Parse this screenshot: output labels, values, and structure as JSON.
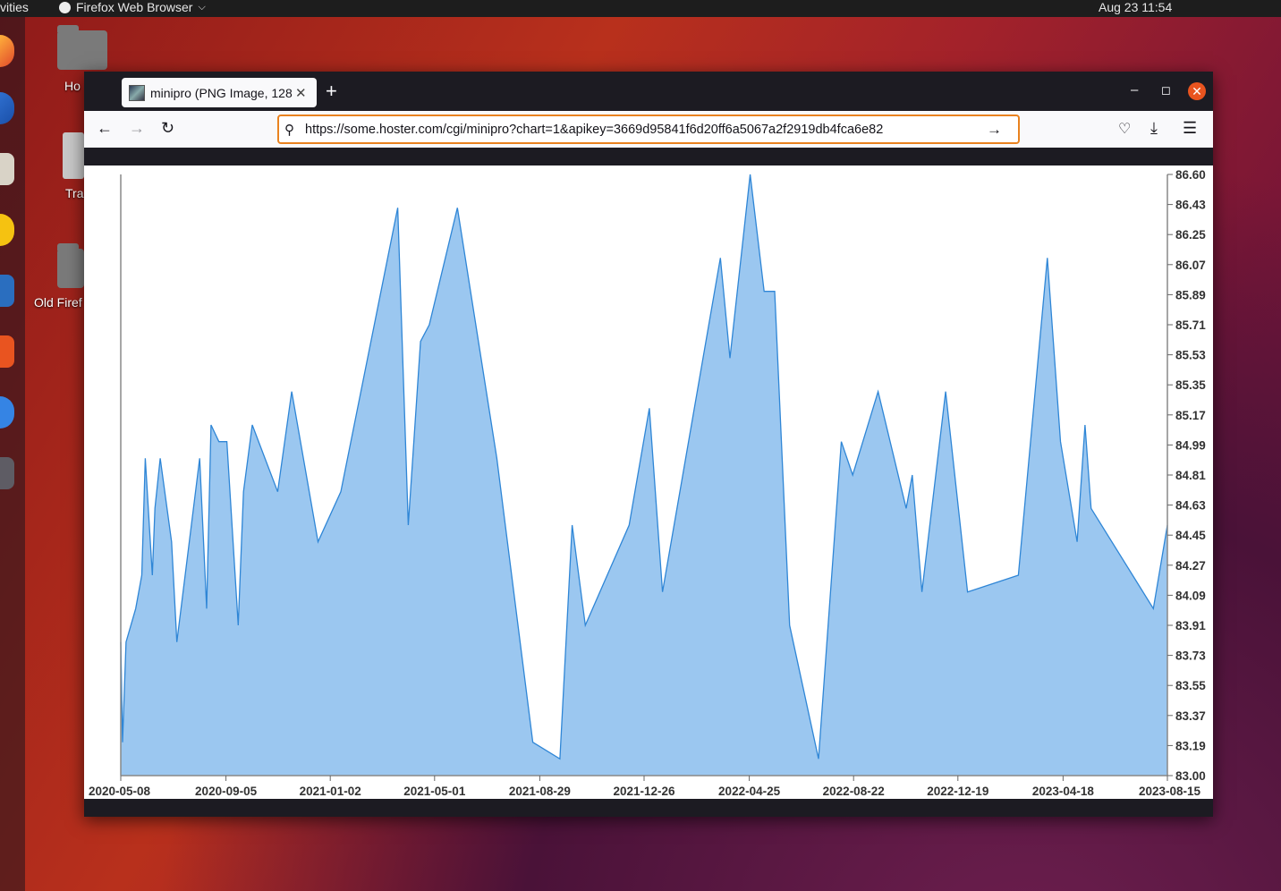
{
  "topbar": {
    "activities": "vities",
    "app_name": "Firefox Web Browser",
    "clock": "Aug 23  11:54"
  },
  "desktop": {
    "icons": [
      {
        "label": "Ho"
      },
      {
        "label": "Tra"
      },
      {
        "label": "Old Firef"
      }
    ]
  },
  "browser": {
    "tab_title": "minipro (PNG Image, 128",
    "url": "https://some.hoster.com/cgi/minipro?chart=1&apikey=3669d95841f6d20ff6a5067a2f2919db4fca6e82"
  },
  "chart_data": {
    "type": "area",
    "fill_color": "#9bc7f0",
    "line_color": "#2f86d6",
    "x_ticks": [
      "2020-05-08",
      "2020-09-05",
      "2021-01-02",
      "2021-05-01",
      "2021-08-29",
      "2021-12-26",
      "2022-04-25",
      "2022-08-22",
      "2022-12-19",
      "2023-04-18",
      "2023-08-15"
    ],
    "y_ticks": [
      "86.60",
      "86.43",
      "86.25",
      "86.07",
      "85.89",
      "85.71",
      "85.53",
      "85.35",
      "85.17",
      "84.99",
      "84.81",
      "84.63",
      "84.45",
      "84.27",
      "84.09",
      "83.91",
      "83.73",
      "83.55",
      "83.37",
      "83.19",
      "83.00"
    ],
    "ylim": [
      83.0,
      86.6
    ],
    "xlim": [
      "2020-05-08",
      "2023-08-15"
    ],
    "grid": false,
    "points": [
      [
        "2020-05-08",
        83.8
      ],
      [
        "2020-05-10",
        83.2
      ],
      [
        "2020-05-14",
        83.8
      ],
      [
        "2020-05-25",
        84.0
      ],
      [
        "2020-06-01",
        84.2
      ],
      [
        "2020-06-05",
        84.9
      ],
      [
        "2020-06-13",
        84.2
      ],
      [
        "2020-06-16",
        84.6
      ],
      [
        "2020-06-22",
        84.9
      ],
      [
        "2020-07-05",
        84.4
      ],
      [
        "2020-07-11",
        83.8
      ],
      [
        "2020-08-06",
        84.9
      ],
      [
        "2020-08-14",
        84.0
      ],
      [
        "2020-08-19",
        85.1
      ],
      [
        "2020-08-28",
        85.0
      ],
      [
        "2020-09-06",
        85.0
      ],
      [
        "2020-09-19",
        83.9
      ],
      [
        "2020-09-25",
        84.7
      ],
      [
        "2020-10-05",
        85.1
      ],
      [
        "2020-11-03",
        84.7
      ],
      [
        "2020-11-19",
        85.3
      ],
      [
        "2020-12-19",
        84.4
      ],
      [
        "2021-01-14",
        84.7
      ],
      [
        "2021-03-20",
        86.4
      ],
      [
        "2021-04-01",
        84.5
      ],
      [
        "2021-04-15",
        85.6
      ],
      [
        "2021-04-25",
        85.7
      ],
      [
        "2021-05-27",
        86.4
      ],
      [
        "2021-07-11",
        84.9
      ],
      [
        "2021-08-21",
        83.2
      ],
      [
        "2021-09-21",
        83.1
      ],
      [
        "2021-10-05",
        84.5
      ],
      [
        "2021-10-20",
        83.9
      ],
      [
        "2021-12-09",
        84.5
      ],
      [
        "2022-01-01",
        85.2
      ],
      [
        "2022-01-16",
        84.1
      ],
      [
        "2022-03-23",
        86.1
      ],
      [
        "2022-04-03",
        85.5
      ],
      [
        "2022-04-26",
        86.6
      ],
      [
        "2022-05-12",
        85.9
      ],
      [
        "2022-05-24",
        85.9
      ],
      [
        "2022-06-10",
        83.9
      ],
      [
        "2022-07-13",
        83.1
      ],
      [
        "2022-08-08",
        85.0
      ],
      [
        "2022-08-21",
        84.8
      ],
      [
        "2022-09-19",
        85.3
      ],
      [
        "2022-10-21",
        84.6
      ],
      [
        "2022-10-28",
        84.8
      ],
      [
        "2022-11-08",
        84.1
      ],
      [
        "2022-12-05",
        85.3
      ],
      [
        "2022-12-30",
        84.1
      ],
      [
        "2023-02-26",
        84.2
      ],
      [
        "2023-03-31",
        86.1
      ],
      [
        "2023-04-15",
        85.0
      ],
      [
        "2023-05-04",
        84.4
      ],
      [
        "2023-05-13",
        85.1
      ],
      [
        "2023-05-20",
        84.6
      ],
      [
        "2023-07-30",
        84.0
      ],
      [
        "2023-08-15",
        84.5
      ]
    ]
  }
}
